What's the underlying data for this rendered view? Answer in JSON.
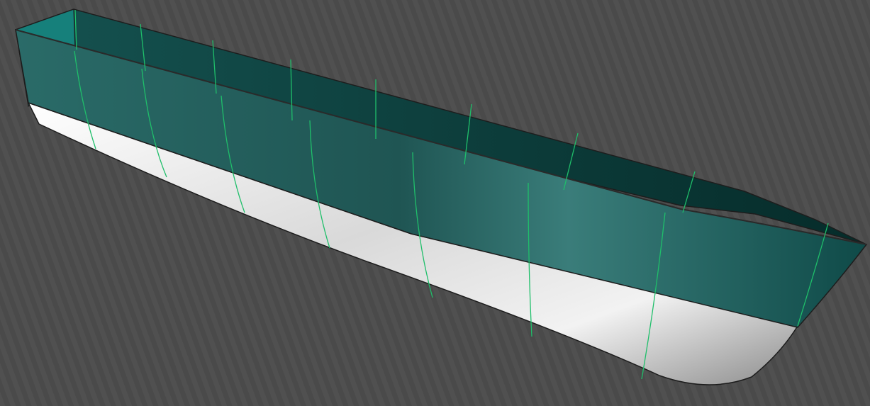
{
  "scene": {
    "background_color": "#4a4a4a",
    "hull_topside_color": "#1f5c5a",
    "hull_interior_color": "#0b3b39",
    "hull_bottom_color": "#e6e6e6",
    "station_line_color": "#1fbf6a",
    "edge_color": "#2a2a2a"
  }
}
